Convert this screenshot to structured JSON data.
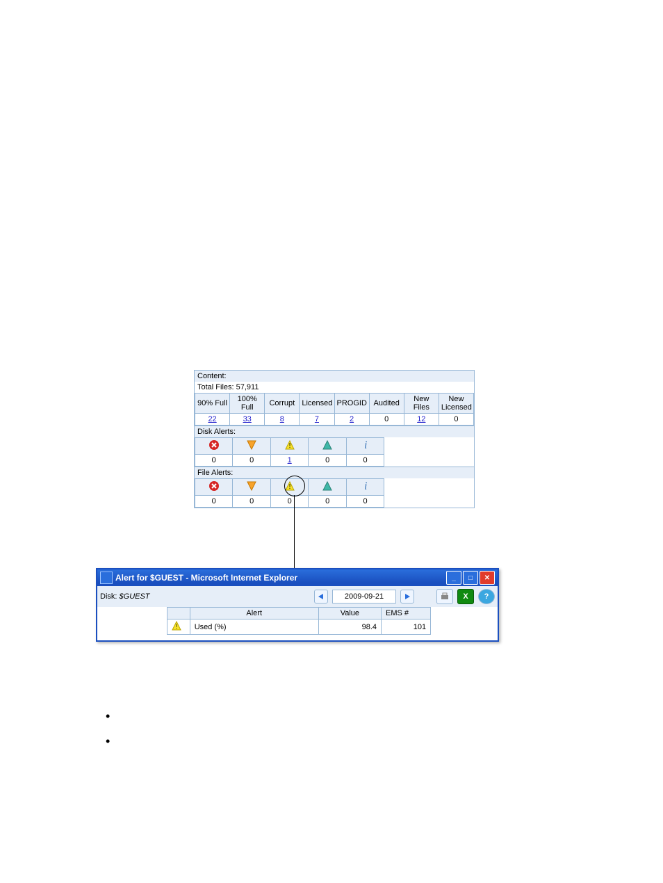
{
  "panel": {
    "content_label": "Content:",
    "total_files_label": "Total Files: 57,911",
    "headers": [
      "90% Full",
      "100% Full",
      "Corrupt",
      "Licensed",
      "PROGID",
      "Audited",
      "New Files",
      "New Licensed"
    ],
    "values": [
      "22",
      "33",
      "8",
      "7",
      "2",
      "0",
      "12",
      "0"
    ],
    "links": [
      true,
      true,
      true,
      true,
      true,
      false,
      true,
      false
    ],
    "disk_alerts_label": "Disk Alerts:",
    "disk_alerts_values": [
      "0",
      "0",
      "1",
      "0",
      "0"
    ],
    "disk_alerts_links": [
      false,
      false,
      true,
      false,
      false
    ],
    "file_alerts_label": "File Alerts:",
    "file_alerts_values": [
      "0",
      "0",
      "0",
      "0",
      "0"
    ],
    "alert_icon_names": [
      "error-icon",
      "warning-orange-icon",
      "warning-yellow-icon",
      "up-triangle-icon",
      "info-icon"
    ]
  },
  "popup": {
    "title": "Alert for $GUEST - Microsoft Internet Explorer",
    "disk_label": "Disk:",
    "disk_name": "$GUEST",
    "date": "2009-09-21",
    "cols": [
      "",
      "Alert",
      "Value",
      "EMS #"
    ],
    "row": {
      "alert": "Used (%)",
      "value": "98.4",
      "ems": "101"
    }
  }
}
